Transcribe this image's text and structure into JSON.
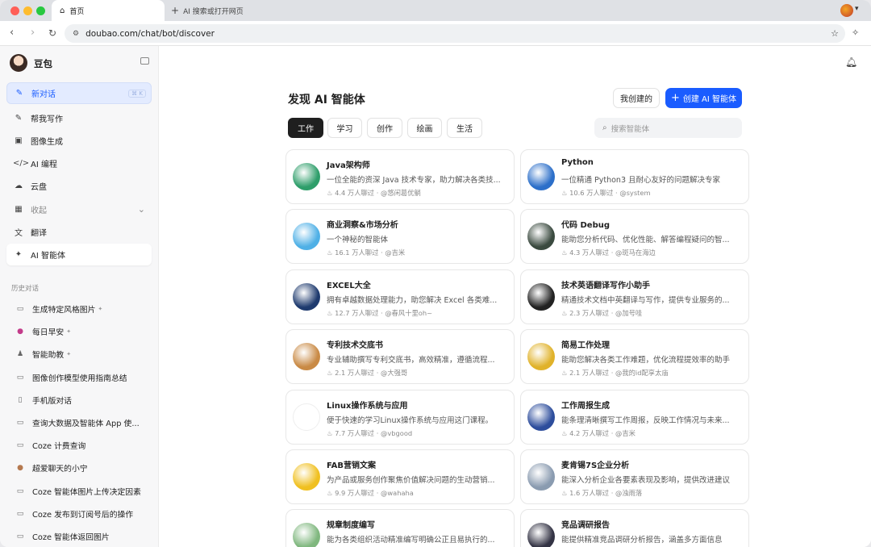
{
  "browser": {
    "tab_active_label": "首页",
    "tab_new_label": "AI 搜索或打开网页",
    "url": "doubao.com/chat/bot/discover"
  },
  "sidebar": {
    "app_name": "豆包",
    "new_chat_label": "新对话",
    "shortcut": "⌘ K",
    "nav": [
      {
        "icon": "✎",
        "label": "帮我写作"
      },
      {
        "icon": "▣",
        "label": "图像生成"
      },
      {
        "icon": "</>",
        "label": "AI 编程"
      },
      {
        "icon": "☁",
        "label": "云盘"
      },
      {
        "icon": "▦",
        "label": "收起"
      },
      {
        "icon": "文",
        "label": "翻译"
      },
      {
        "icon": "✦",
        "label": "AI 智能体"
      }
    ],
    "history_title": "历史对话",
    "history": [
      {
        "icon": "▭",
        "label": "生成特定风格图片",
        "pinned": true
      },
      {
        "icon": "●",
        "label": "每日早安",
        "pinned": true
      },
      {
        "icon": "♟",
        "label": "智能助教",
        "pinned": true
      },
      {
        "icon": "▭",
        "label": "图像创作模型使用指南总结",
        "pinned": false
      },
      {
        "icon": "▯",
        "label": "手机版对话",
        "pinned": false
      },
      {
        "icon": "▭",
        "label": "查询大数据及智能体 App 使...",
        "pinned": false
      },
      {
        "icon": "▭",
        "label": "Coze 计费查询",
        "pinned": false
      },
      {
        "icon": "●",
        "label": "超爱聊天的小宁",
        "pinned": false
      },
      {
        "icon": "▭",
        "label": "Coze 智能体图片上传决定因素",
        "pinned": false
      },
      {
        "icon": "▭",
        "label": "Coze 发布到订阅号后的操作",
        "pinned": false
      },
      {
        "icon": "▭",
        "label": "Coze 智能体返回图片",
        "pinned": false
      }
    ]
  },
  "main": {
    "title": "发现 AI 智能体",
    "my_created_label": "我创建的",
    "create_label": "创建 AI 智能体",
    "search_placeholder": "搜索智能体",
    "categories": [
      "工作",
      "学习",
      "创作",
      "绘画",
      "生活"
    ],
    "bots": [
      {
        "title": "Java架构师",
        "desc": "一位全能的资深 Java 技术专家，助力解决各类技...",
        "views": "4.4 万人聊过",
        "author": "@悠闲葛优躺",
        "av": "#2e9e6a"
      },
      {
        "title": "Python",
        "desc": "一位精通 Python3 且耐心友好的问题解决专家",
        "views": "10.6 万人聊过",
        "author": "@system",
        "av": "#2c6fc9"
      },
      {
        "title": "商业洞察&市场分析",
        "desc": "一个神秘的智能体",
        "views": "16.1 万人聊过",
        "author": "@吉米",
        "av": "#4fb0e6"
      },
      {
        "title": "代码 Debug",
        "desc": "能助您分析代码、优化性能、解答编程疑问的智...",
        "views": "4.3 万人聊过",
        "author": "@斑马在海边",
        "av": "#3a4a3f"
      },
      {
        "title": "EXCEL大全",
        "desc": "拥有卓越数据处理能力，助您解决 Excel 各类难...",
        "views": "12.7 万人聊过",
        "author": "@春风十里oh~",
        "av": "#1e3a6e"
      },
      {
        "title": "技术英语翻译写作小助手",
        "desc": "精通技术文档中英翻译与写作，提供专业服务的...",
        "views": "2.3 万人聊过",
        "author": "@加号哇",
        "av": "#222222"
      },
      {
        "title": "专利技术交底书",
        "desc": "专业辅助撰写专利交底书，高效精准，遵循流程...",
        "views": "2.1 万人聊过",
        "author": "@大强哥",
        "av": "#c98a45"
      },
      {
        "title": "简易工作处理",
        "desc": "能助您解决各类工作难题，优化流程提效率的助手",
        "views": "2.1 万人聊过",
        "author": "@我的id配享太庙",
        "av": "#e0b22a"
      },
      {
        "title": "Linux操作系统与应用",
        "desc": "便于快速的学习Linux操作系统与应用这门课程。",
        "views": "7.7 万人聊过",
        "author": "@vbgood",
        "av": "#ffffff"
      },
      {
        "title": "工作周报生成",
        "desc": "能条理清晰撰写工作周报，反映工作情况与未来...",
        "views": "4.2 万人聊过",
        "author": "@吉米",
        "av": "#2d4d9c"
      },
      {
        "title": "FAB营销文案",
        "desc": "为产品或服务创作聚焦价值解决问题的生动营销...",
        "views": "9.9 万人聊过",
        "author": "@wahaha",
        "av": "#f0c020"
      },
      {
        "title": "麦肯锡7S企业分析",
        "desc": "能深入分析企业各要素表现及影响，提供改进建议",
        "views": "1.6 万人聊过",
        "author": "@浊雨落",
        "av": "#8a9bb0"
      },
      {
        "title": "规章制度编写",
        "desc": "能为各类组织活动精准编写明确公正且易执行的...",
        "views": "",
        "author": "",
        "av": "#7fb77e"
      },
      {
        "title": "竞品调研报告",
        "desc": "能提供精准竞品调研分析报告，涵盖多方面信息",
        "views": "",
        "author": "",
        "av": "#333344"
      }
    ]
  },
  "colors": {
    "accent": "#1a5cff",
    "dark_chip": "#1f1f1f"
  }
}
